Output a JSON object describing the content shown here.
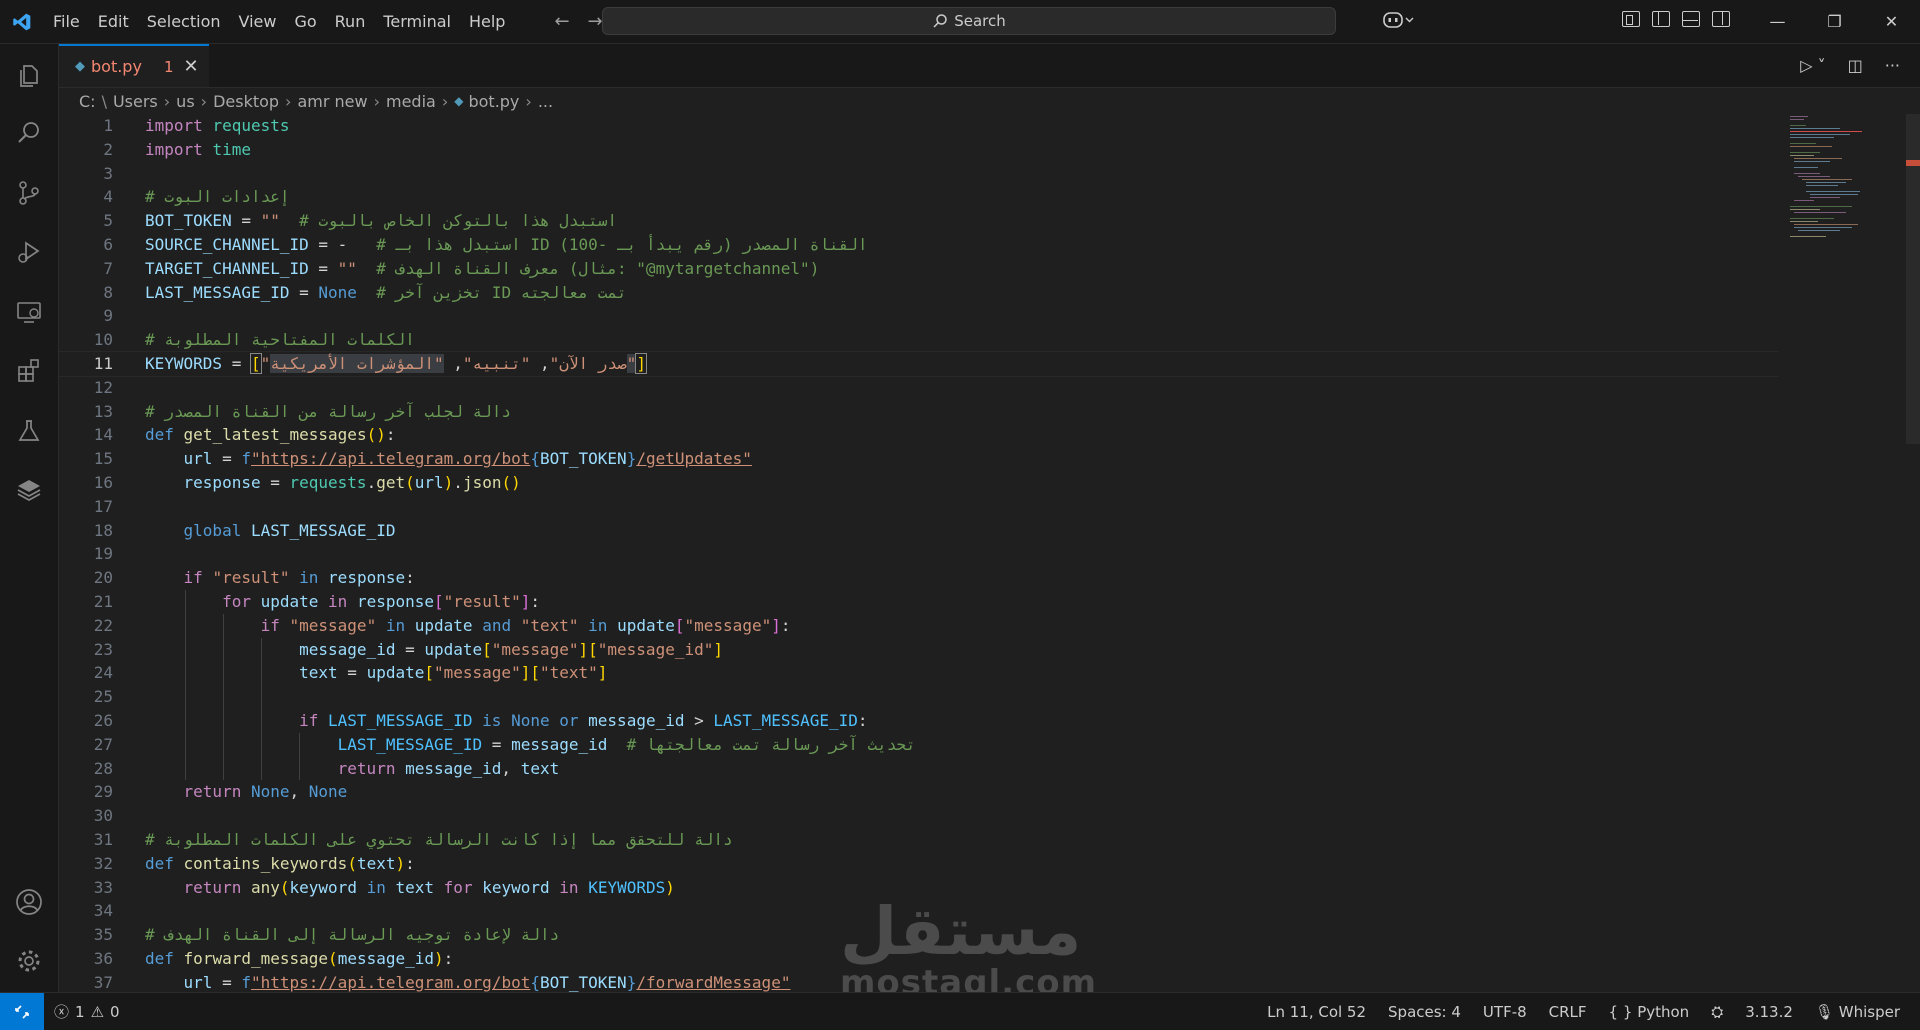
{
  "menu": [
    "File",
    "Edit",
    "Selection",
    "View",
    "Go",
    "Run",
    "Terminal",
    "Help"
  ],
  "search": {
    "label": "Search"
  },
  "tab": {
    "name": "bot.py",
    "problems": "1",
    "icon": "python-file-icon"
  },
  "breadcrumb": [
    "C:",
    "Users",
    "us",
    "Desktop",
    "amr new",
    "media",
    "bot.py",
    "..."
  ],
  "editor": {
    "active_line": 11,
    "lines": [
      "1",
      "2",
      "3",
      "4",
      "5",
      "6",
      "7",
      "8",
      "9",
      "10",
      "11",
      "12",
      "13",
      "14",
      "15",
      "16",
      "17",
      "18",
      "19",
      "20",
      "21",
      "22",
      "23",
      "24",
      "25",
      "26",
      "27",
      "28",
      "29",
      "30",
      "31",
      "32",
      "33",
      "34",
      "35",
      "36",
      "37"
    ],
    "code": {
      "l1_kw": "import",
      "l1_mod": "requests",
      "l2_kw": "import",
      "l2_mod": "time",
      "l4": "# إعدادات البوت",
      "l5_var": "BOT_TOKEN",
      "l5_val": "\"\"",
      "l5_cm": "# استبدل هذا بالتوكن الخاص بالبوت",
      "l6_var": "SOURCE_CHANNEL_ID",
      "l6_val": "-",
      "l6_cm": "# استبدل هذا بـ ID القناة المصدر (رقم يبدأ بـ -100)",
      "l7_var": "TARGET_CHANNEL_ID",
      "l7_val": "\"\"",
      "l7_cm": "# معرف القناة الهدف (مثال: \"@mytargetchannel\")",
      "l8_var": "LAST_MESSAGE_ID",
      "l8_val": "None",
      "l8_cm": "# تخزين آخر ID تمت معالجته",
      "l10": "# الكلمات المفتاحية المطلوبة",
      "l11_var": "KEYWORDS",
      "l11_s1": "\"صدر الآن\"",
      "l11_s2": "\"تنبيه\"",
      "l11_s3": "\"المؤشرات الأمريكية\"",
      "l13": "# دالة لجلب آخر رسالة من القناة المصدر",
      "l14_kw": "def",
      "l14_fn": "get_latest_messages",
      "l15_var": "url",
      "l15_f": "f",
      "l15_s1": "\"https://api.telegram.org/bot",
      "l15_v": "BOT_TOKEN",
      "l15_s2": "/getUpdates\"",
      "l16_var": "response",
      "l16_mod": "requests",
      "l16_fn": "get",
      "l16_arg": "url",
      "l16_fn2": "json",
      "l18_kw": "global",
      "l18_var": "LAST_MESSAGE_ID",
      "l20_kw": "if",
      "l20_s": "\"result\"",
      "l20_in": "in",
      "l20_var": "response",
      "l21_kw": "for",
      "l21_var": "update",
      "l21_in": "in",
      "l21_var2": "response",
      "l21_s": "\"result\"",
      "l22_kw": "if",
      "l22_s1": "\"message\"",
      "l22_in": "in",
      "l22_var": "update",
      "l22_and": "and",
      "l22_s2": "\"text\"",
      "l22_in2": "in",
      "l22_var2": "update",
      "l22_s3": "\"message\"",
      "l23_var": "message_id",
      "l23_var2": "update",
      "l23_s1": "\"message\"",
      "l23_s2": "\"message_id\"",
      "l24_var": "text",
      "l24_var2": "update",
      "l24_s1": "\"message\"",
      "l24_s2": "\"text\"",
      "l26_kw": "if",
      "l26_c": "LAST_MESSAGE_ID",
      "l26_is": "is",
      "l26_none": "None",
      "l26_or": "or",
      "l26_var": "message_id",
      "l26_c2": "LAST_MESSAGE_ID",
      "l27_c": "LAST_MESSAGE_ID",
      "l27_var": "message_id",
      "l27_cm": "# تحديث آخر رسالة تمت معالجتها",
      "l28_kw": "return",
      "l28_var": "message_id",
      "l28_var2": "text",
      "l29_kw": "return",
      "l29_v": "None",
      "l29_v2": "None",
      "l31": "# دالة للتحقق مما إذا كانت الرسالة تحتوي على الكلمات المطلوبة",
      "l32_kw": "def",
      "l32_fn": "contains_keywords",
      "l32_arg": "text",
      "l33_kw": "return",
      "l33_fn": "any",
      "l33_v": "keyword",
      "l33_in": "in",
      "l33_v2": "text",
      "l33_for": "for",
      "l33_v3": "keyword",
      "l33_in2": "in",
      "l33_c": "KEYWORDS",
      "l35": "# دالة لإعادة توجيه الرسالة إلى القناة الهدف",
      "l36_kw": "def",
      "l36_fn": "forward_message",
      "l36_arg": "message_id",
      "l37_var": "url",
      "l37_f": "f",
      "l37_s1": "\"https://api.telegram.org/bot",
      "l37_v": "BOT_TOKEN",
      "l37_s2": "/forwardMessage\""
    }
  },
  "watermark": {
    "arabic": "مستقل",
    "latin": "mostaql.com"
  },
  "status": {
    "errors": "1",
    "warnings": "0",
    "position": "Ln 11, Col 52",
    "spaces": "Spaces: 4",
    "encoding": "UTF-8",
    "eol": "CRLF",
    "language": "Python",
    "version": "3.13.2",
    "extension": "Whisper"
  },
  "colors": {
    "accent": "#0078d4",
    "background": "#1f1f1f",
    "chrome": "#181818"
  }
}
